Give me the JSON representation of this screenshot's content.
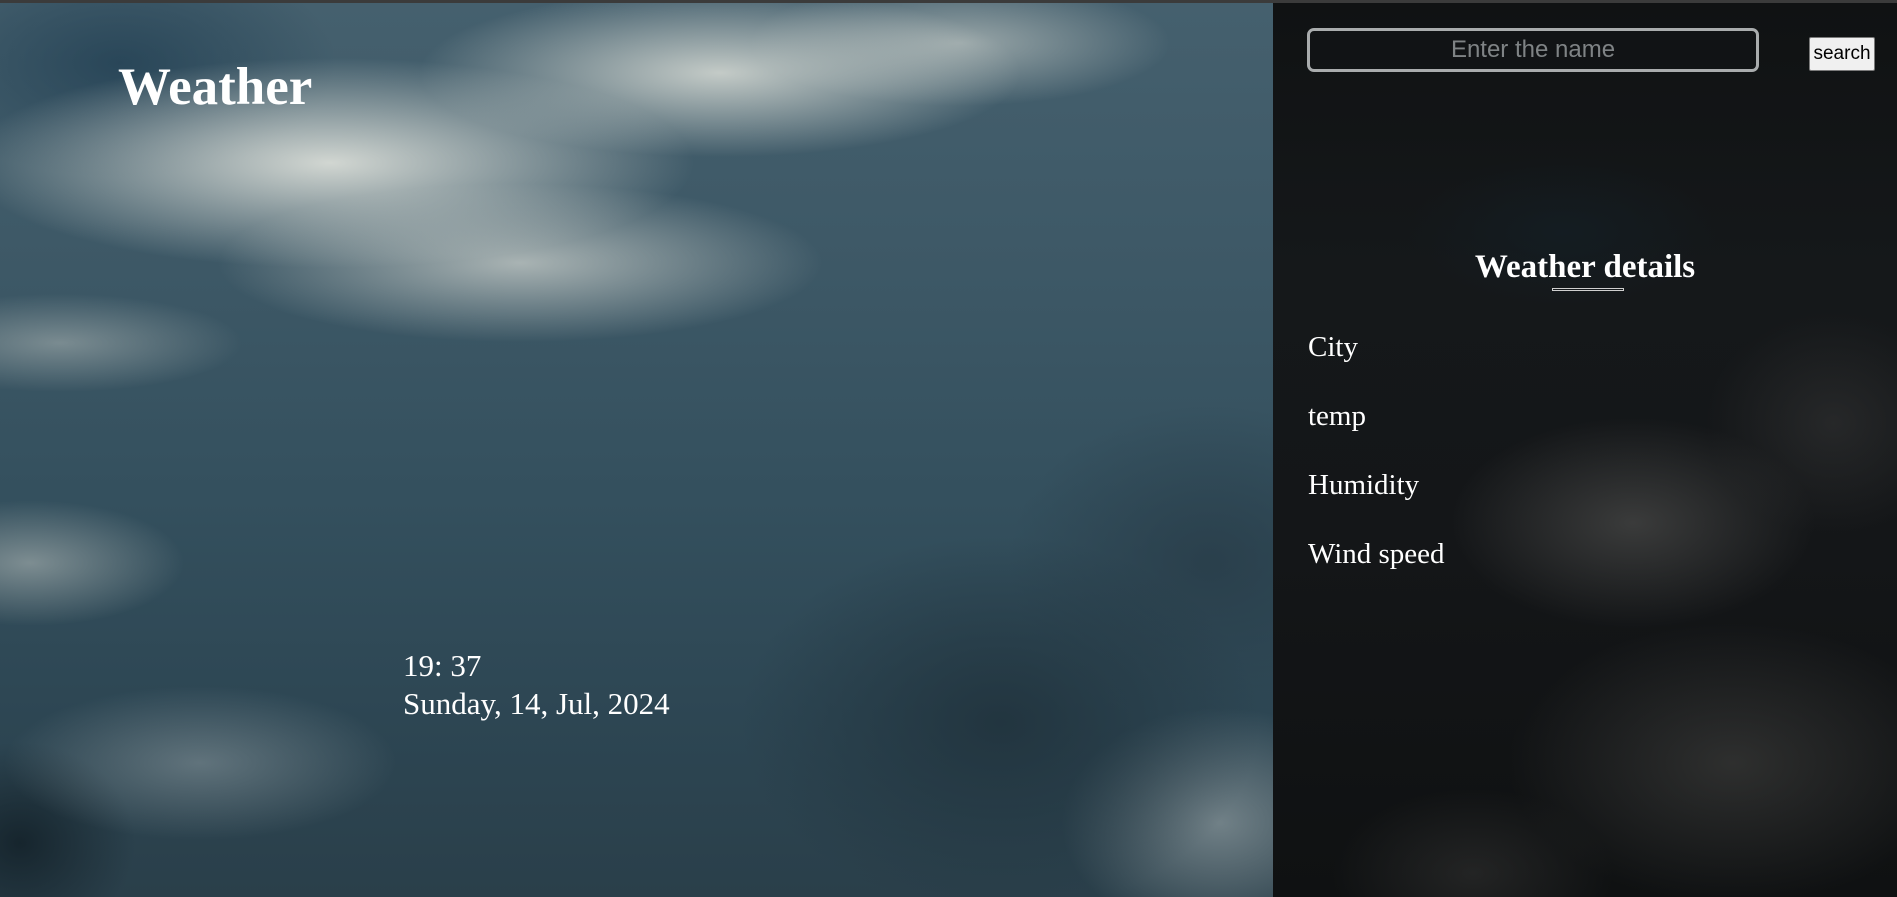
{
  "hero": {
    "title": "Weather",
    "time": "19: 37",
    "date": "Sunday, 14, Jul, 2024"
  },
  "search": {
    "placeholder": "Enter the name",
    "button_label": "search"
  },
  "details": {
    "title": "Weather details",
    "items": [
      {
        "label": "City"
      },
      {
        "label": "temp"
      },
      {
        "label": "Humidity"
      },
      {
        "label": "Wind speed"
      }
    ]
  }
}
